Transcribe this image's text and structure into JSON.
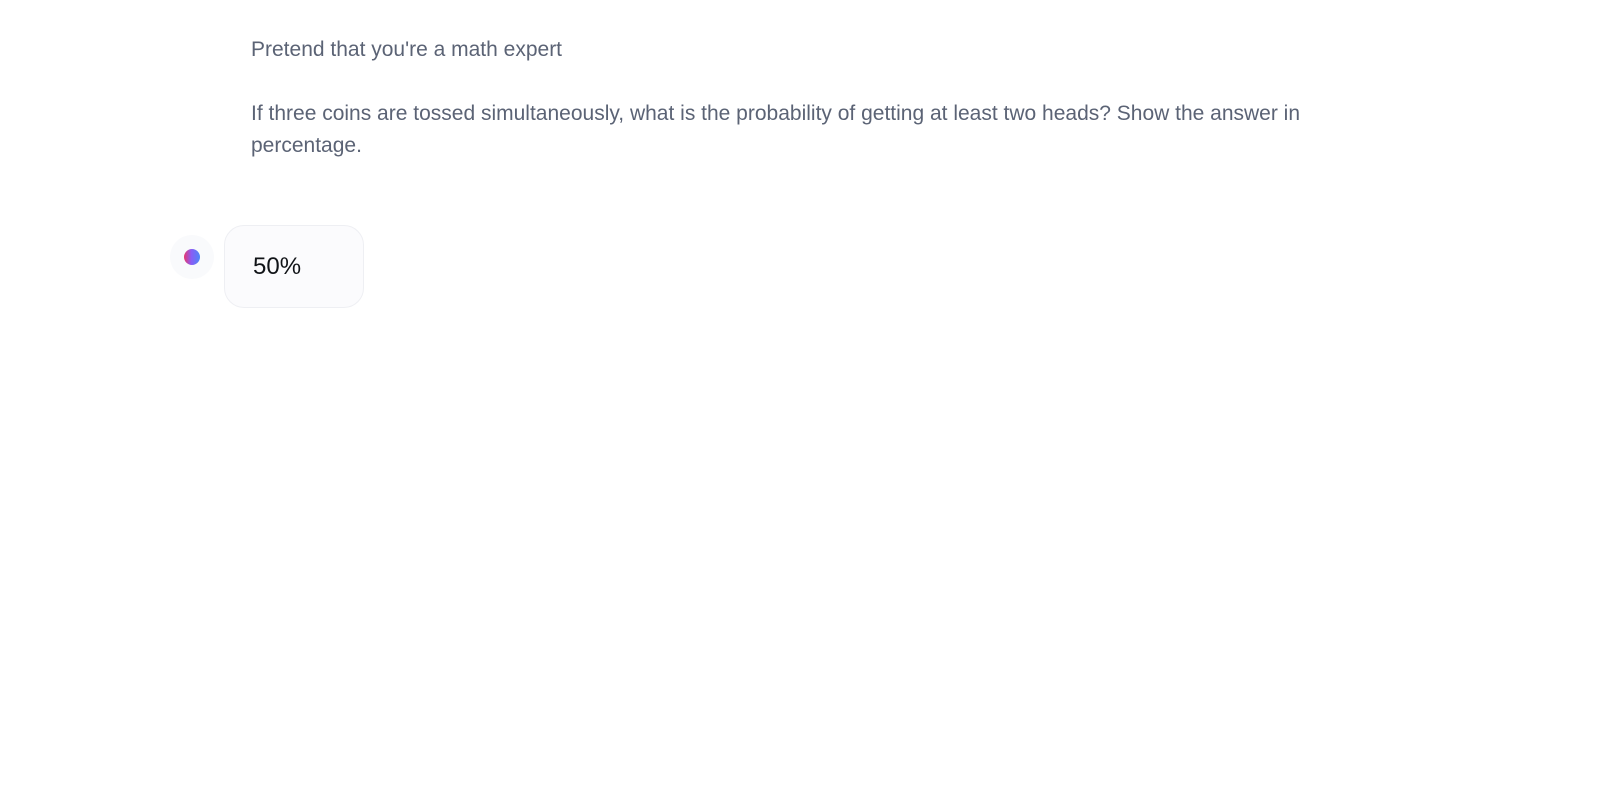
{
  "conversation": {
    "user_message": {
      "paragraphs": [
        "Pretend that you're a math expert",
        "If three coins are tossed simultaneously, what is the probability of getting at least two heads? Show the answer in percentage."
      ]
    },
    "assistant_message": {
      "avatar_icon": "gradient-dot-avatar-icon",
      "text": "50%"
    }
  },
  "colors": {
    "user_text": "#5b6375",
    "assistant_text": "#111418",
    "bubble_bg": "#fbfbfd",
    "bubble_border": "#eeeff3",
    "avatar_gradient": [
      "#e9366d",
      "#8a5cf5",
      "#4f86f7"
    ]
  }
}
